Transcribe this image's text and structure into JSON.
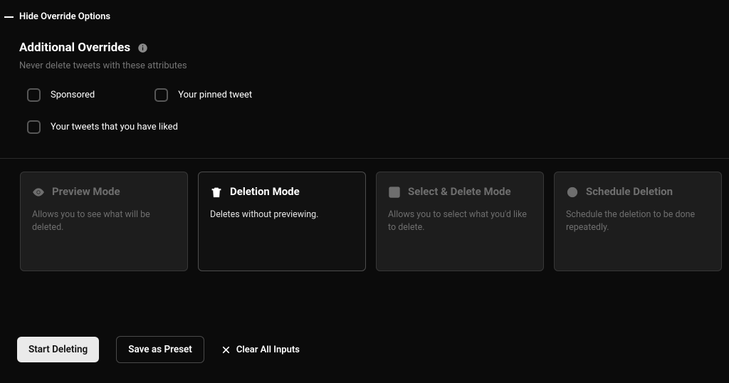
{
  "toggle": {
    "label": "Hide Override Options"
  },
  "overrides": {
    "title": "Additional Overrides",
    "subtitle": "Never delete tweets with these attributes",
    "options": {
      "sponsored": "Sponsored",
      "pinned": "Your pinned tweet",
      "liked": "Your tweets that you have liked"
    }
  },
  "modes": {
    "preview": {
      "title": "Preview Mode",
      "desc": "Allows you to see what will be deleted."
    },
    "deletion": {
      "title": "Deletion Mode",
      "desc": "Deletes without previewing."
    },
    "select": {
      "title": "Select & Delete Mode",
      "desc": "Allows you to select what you'd like to delete."
    },
    "schedule": {
      "title": "Schedule Deletion",
      "desc": "Schedule the deletion to be done repeatedly."
    }
  },
  "footer": {
    "start": "Start Deleting",
    "save": "Save as Preset",
    "clear": "Clear All Inputs"
  }
}
